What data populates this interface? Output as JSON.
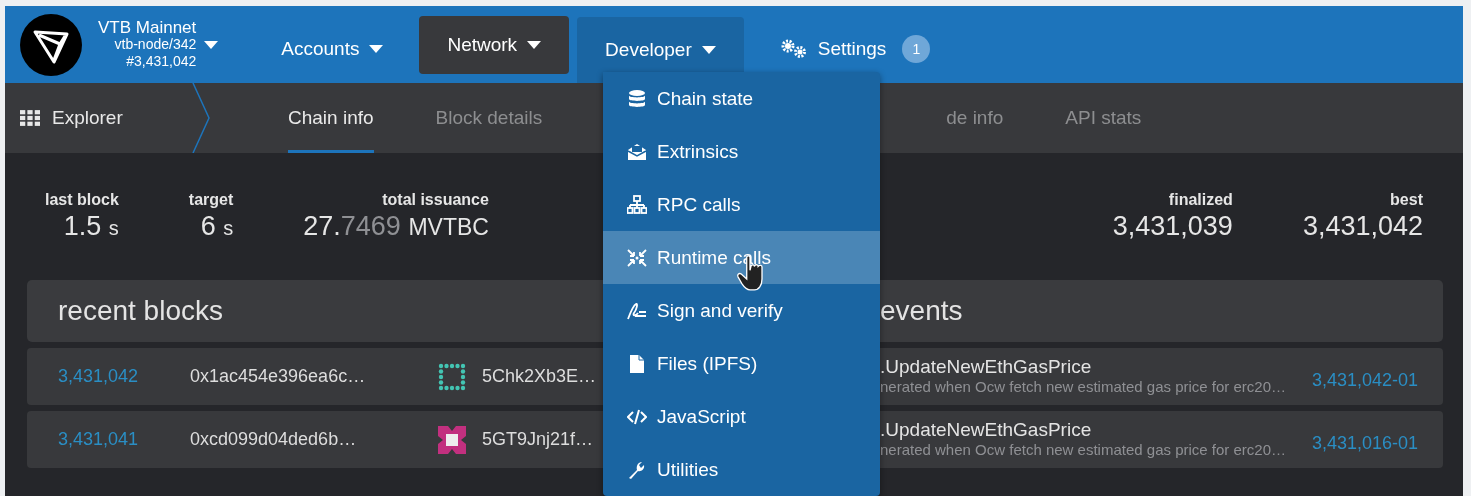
{
  "header": {
    "chain": "VTB Mainnet",
    "node": "vtb-node/342",
    "block": "#3,431,042",
    "nav": [
      {
        "kind": "menu",
        "label": "Accounts",
        "selected": false,
        "expanded": false
      },
      {
        "kind": "menu",
        "label": "Network",
        "selected": true,
        "expanded": false
      },
      {
        "kind": "menu",
        "label": "Developer",
        "selected": false,
        "expanded": true
      },
      {
        "kind": "link",
        "label": "Settings",
        "badge": "1",
        "selected": false,
        "expanded": false
      }
    ]
  },
  "developer_menu": [
    {
      "label": "Chain state",
      "highlighted": false
    },
    {
      "label": "Extrinsics",
      "highlighted": false
    },
    {
      "label": "RPC calls",
      "highlighted": false
    },
    {
      "label": "Runtime calls",
      "highlighted": true
    },
    {
      "label": "Sign and verify",
      "highlighted": false
    },
    {
      "label": "Files (IPFS)",
      "highlighted": false
    },
    {
      "label": "JavaScript",
      "highlighted": false
    },
    {
      "label": "Utilities",
      "highlighted": false
    }
  ],
  "subnav": {
    "section": "Explorer",
    "tabs": [
      {
        "label": "Chain info",
        "selected": true
      },
      {
        "label": "Block details",
        "selected": false
      },
      {
        "label": "de info",
        "selected": false
      },
      {
        "label": "API stats",
        "selected": false
      }
    ]
  },
  "stats": [
    {
      "label": "last block",
      "value": "1.5",
      "unit": "s"
    },
    {
      "label": "target",
      "value": "6",
      "unit": "s"
    },
    {
      "label": "total issuance",
      "value": "27.",
      "decimals": "7469",
      "unit": "MVTBC"
    },
    {
      "label": "finalized",
      "value": "3,431,039"
    },
    {
      "label": "best",
      "value": "3,431,042"
    }
  ],
  "recent_blocks": {
    "title": "recent blocks",
    "rows": [
      {
        "number": "3,431,042",
        "hash": "0x1ac454e396ea6c…",
        "author": "5Chk2Xb3E…"
      },
      {
        "number": "3,431,041",
        "hash": "0xcd099d04ded6b…",
        "author": "5GT9Jnj21f…"
      }
    ]
  },
  "events": {
    "title": "events",
    "rows": [
      {
        "name": ".UpdateNewEthGasPrice",
        "description": "nerated when Ocw fetch new estimated gas price for erc20…",
        "link": "3,431,042-01"
      },
      {
        "name": ".UpdateNewEthGasPrice",
        "description": "nerated when Ocw fetch new estimated gas price for erc20…",
        "link": "3,431,016-01"
      }
    ]
  }
}
